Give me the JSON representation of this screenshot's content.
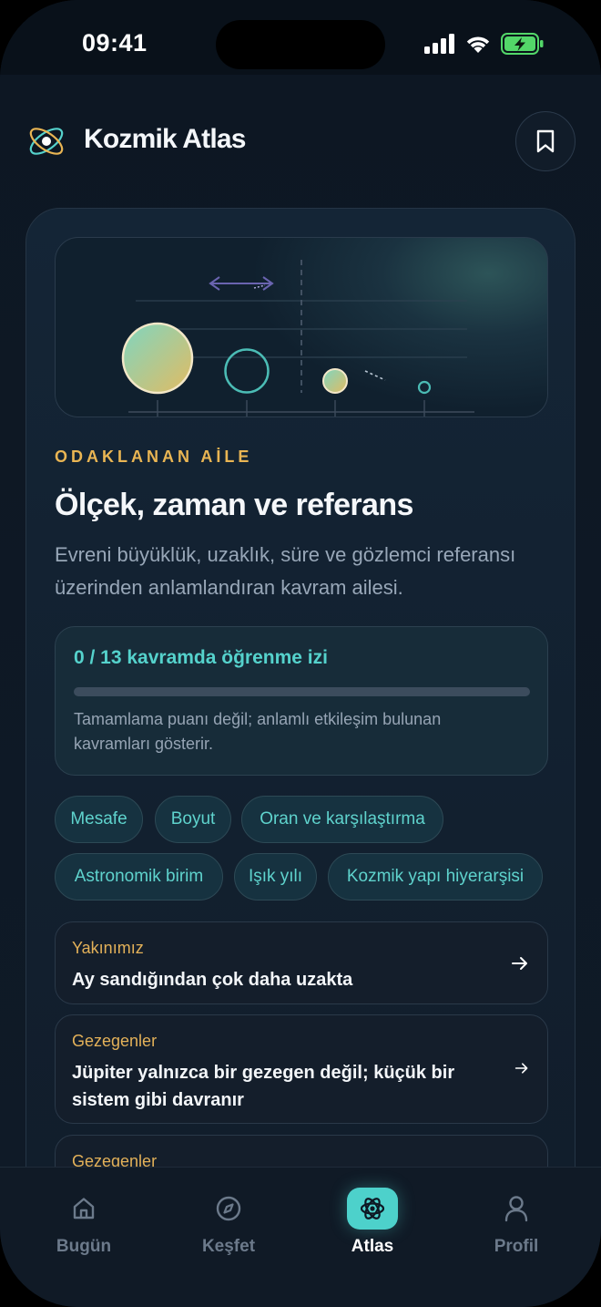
{
  "status_bar": {
    "time": "09:41",
    "icons": [
      "cellular-signal-icon",
      "wifi-icon",
      "battery-charging-icon"
    ],
    "battery_color": "#53d769"
  },
  "header": {
    "app_title": "Kozmik Atlas",
    "logo_icon": "orbit-logo-icon",
    "bookmark_icon": "bookmark-icon"
  },
  "focus_card": {
    "eyebrow": "ODAKLANAN AİLE",
    "title": "Ölçek, zaman ve referans",
    "description": "Evreni büyüklük, uzaklık, süre ve gözlemci referansı üzerinden anlamlandıran kavram ailesi.",
    "progress": {
      "label": "0 / 13 kavramda öğrenme izi",
      "completed": 0,
      "total": 13,
      "note": "Tamamlama puanı değil; anlamlı etkileşim bulunan kavramları gösterir."
    },
    "tags": [
      "Mesafe",
      "Boyut",
      "Oran ve karşılaştırma",
      "Astronomik birim",
      "Işık yılı",
      "Kozmik yapı hiyerarşisi"
    ],
    "lessons": [
      {
        "category": "Yakınımız",
        "title": "Ay sandığından çok daha uzakta"
      },
      {
        "category": "Gezegenler",
        "title": "Jüpiter yalnızca bir gezegen değil; küçük bir sistem gibi davranır"
      },
      {
        "category": "Gezegenler",
        "title": ""
      }
    ]
  },
  "tabbar": {
    "tabs": [
      {
        "label": "Bugün",
        "icon": "home-icon",
        "active": false
      },
      {
        "label": "Keşfet",
        "icon": "compass-icon",
        "active": false
      },
      {
        "label": "Atlas",
        "icon": "atom-icon",
        "active": true
      },
      {
        "label": "Profil",
        "icon": "user-icon",
        "active": false
      }
    ]
  },
  "colors": {
    "background": "#0e1824",
    "accent_teal": "#55d2cc",
    "accent_gold": "#e9b553",
    "text_muted": "#98a7b8"
  }
}
